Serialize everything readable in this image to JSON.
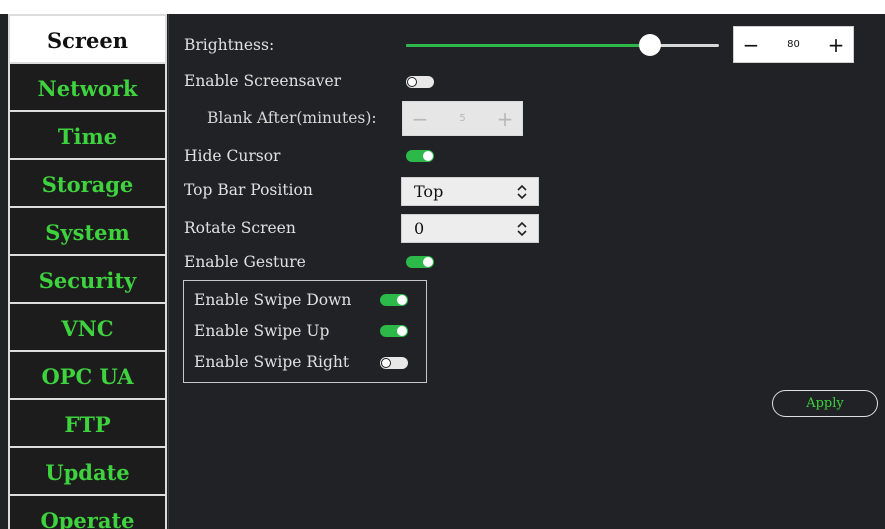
{
  "sidebar": {
    "items": [
      {
        "label": "Screen",
        "active": true
      },
      {
        "label": "Network",
        "active": false
      },
      {
        "label": "Time",
        "active": false
      },
      {
        "label": "Storage",
        "active": false
      },
      {
        "label": "System",
        "active": false
      },
      {
        "label": "Security",
        "active": false
      },
      {
        "label": "VNC",
        "active": false
      },
      {
        "label": "OPC UA",
        "active": false
      },
      {
        "label": "FTP",
        "active": false
      },
      {
        "label": "Update",
        "active": false
      },
      {
        "label": "Operate",
        "active": false
      }
    ]
  },
  "settings": {
    "brightness": {
      "label": "Brightness:",
      "value": "80",
      "level_percent": 78,
      "minus": "−",
      "plus": "+"
    },
    "screensaver": {
      "label": "Enable Screensaver",
      "enabled": false
    },
    "blank_after": {
      "label": "Blank After(minutes):",
      "value": "5",
      "minus": "−",
      "plus": "+",
      "disabled": true
    },
    "hide_cursor": {
      "label": "Hide Cursor",
      "enabled": true
    },
    "top_bar_position": {
      "label": "Top Bar Position",
      "value": "Top"
    },
    "rotate_screen": {
      "label": "Rotate Screen",
      "value": "0"
    },
    "gesture": {
      "label": "Enable Gesture",
      "enabled": true
    },
    "swipe_down": {
      "label": "Enable Swipe Down",
      "enabled": true
    },
    "swipe_up": {
      "label": "Enable Swipe Up",
      "enabled": true
    },
    "swipe_right": {
      "label": "Enable Swipe Right",
      "enabled": false
    }
  },
  "apply_label": "Apply",
  "colors": {
    "accent_green": "#3fd23f",
    "toggle_green": "#2db84a",
    "background": "#202225",
    "sidebar_item_bg": "#1c1c1c"
  },
  "icons": {
    "select_chevron": "chevron-up-down-icon"
  }
}
